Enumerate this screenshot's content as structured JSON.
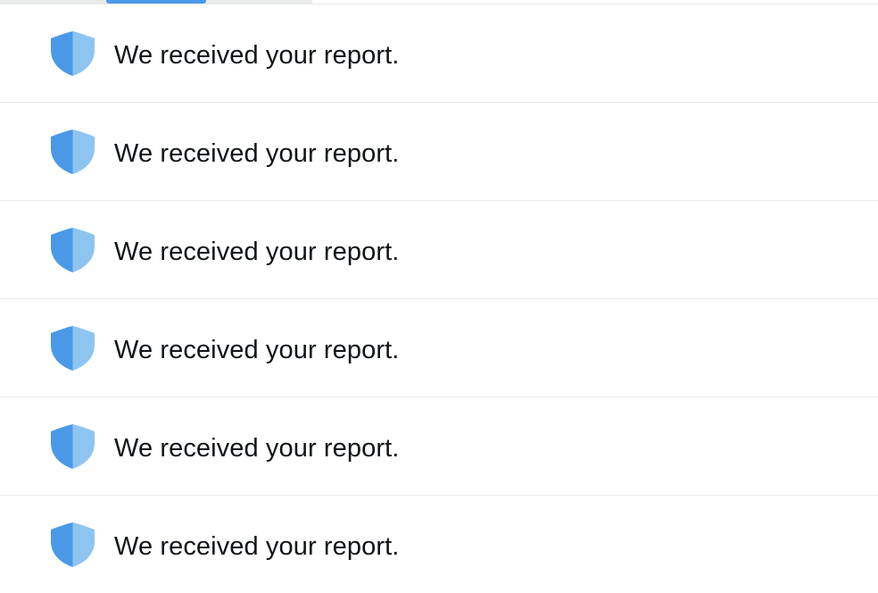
{
  "colors": {
    "shield_dark": "#4a99e9",
    "shield_light": "#8ec5f0",
    "tab_indicator": "#4a99e9",
    "text": "#0f1419",
    "divider": "#e6e9ec"
  },
  "notifications": [
    {
      "icon": "shield-icon",
      "text": "We received your report."
    },
    {
      "icon": "shield-icon",
      "text": "We received your report."
    },
    {
      "icon": "shield-icon",
      "text": "We received your report."
    },
    {
      "icon": "shield-icon",
      "text": "We received your report."
    },
    {
      "icon": "shield-icon",
      "text": "We received your report."
    },
    {
      "icon": "shield-icon",
      "text": "We received your report."
    }
  ]
}
